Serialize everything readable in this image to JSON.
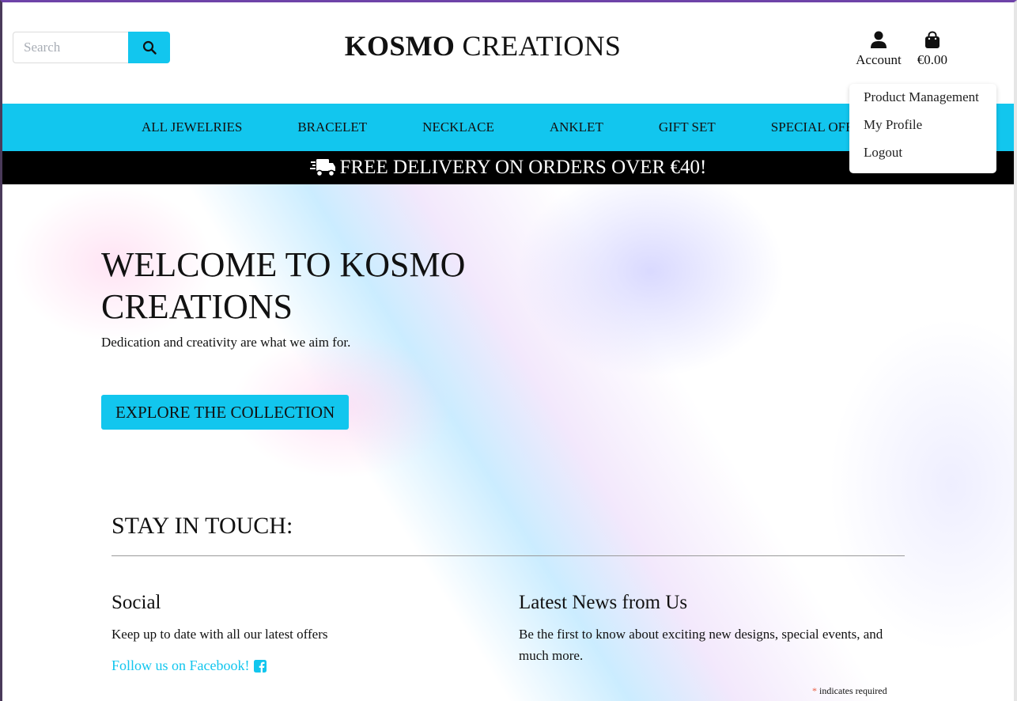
{
  "header": {
    "search": {
      "placeholder": "Search",
      "value": ""
    },
    "brand": {
      "bold": "KOSMO",
      "rest": " CREATIONS"
    },
    "account_label": "Account",
    "cart_total": "€0.00"
  },
  "nav": {
    "items": [
      "ALL JEWELRIES",
      "BRACELET",
      "NECKLACE",
      "ANKLET",
      "GIFT SET",
      "SPECIAL OFFERS"
    ]
  },
  "account_menu": {
    "items": [
      "Product Management",
      "My Profile",
      "Logout"
    ]
  },
  "banner": {
    "text": "FREE DELIVERY ON ORDERS OVER €40!"
  },
  "hero": {
    "title": "WELCOME TO KOSMO CREATIONS",
    "subtitle": "Dedication and creativity are what we aim for.",
    "cta": "EXPLORE THE COLLECTION"
  },
  "stay_in_touch": {
    "title": "STAY IN TOUCH:",
    "social": {
      "title": "Social",
      "text": "Keep up to date with all our latest offers",
      "link": "Follow us on Facebook!"
    },
    "news": {
      "title": "Latest News from Us",
      "text": "Be the first to know about exciting new designs, special events, and much more.",
      "required_asterisk": "*",
      "required_note": "indicates required"
    }
  },
  "colors": {
    "accent": "#12c6ee",
    "banner_bg": "#000000",
    "text": "#111111",
    "asterisk": "#e85c41"
  },
  "icons": {
    "search": "search-icon",
    "account": "user-icon",
    "cart": "shopping-bag-icon",
    "delivery": "truck-icon",
    "facebook": "facebook-icon"
  }
}
